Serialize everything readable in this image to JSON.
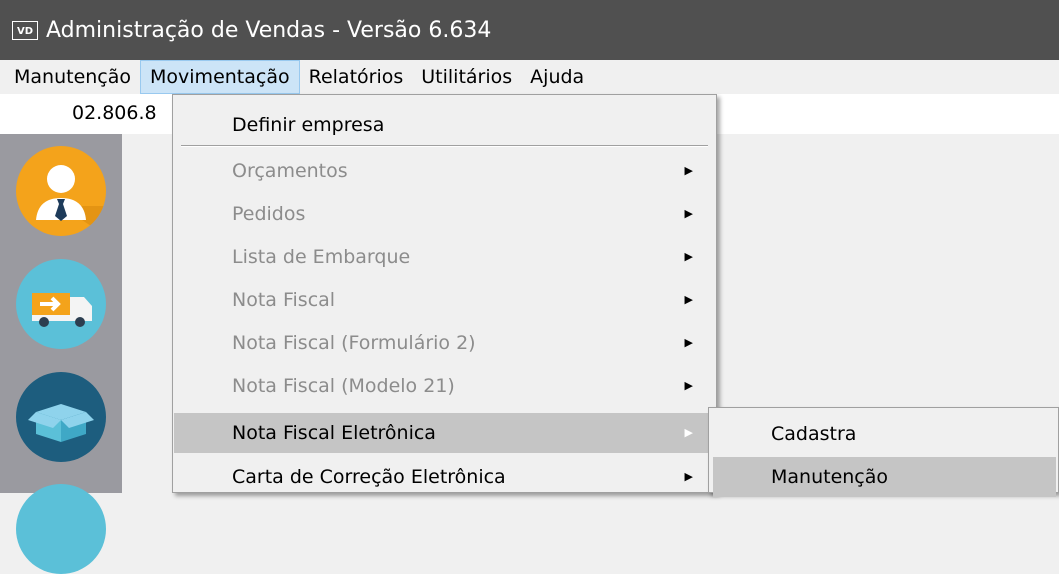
{
  "window": {
    "app_icon": "VD",
    "title": "Administração de Vendas - Versão 6.634"
  },
  "menubar": {
    "items": [
      {
        "label": "Manutenção"
      },
      {
        "label": "Movimentação"
      },
      {
        "label": "Relatórios"
      },
      {
        "label": "Utilitários"
      },
      {
        "label": "Ajuda"
      }
    ],
    "active": "Movimentação"
  },
  "company_field": {
    "value": "02.806.8"
  },
  "sidepanel": {
    "icons": [
      "user-tie-icon",
      "delivery-truck-icon",
      "open-box-icon",
      "partial-icon"
    ]
  },
  "dropdown": {
    "items": [
      {
        "label": "Definir empresa",
        "disabled": false,
        "submenu": false
      },
      {
        "label": "Orçamentos",
        "disabled": true,
        "submenu": true
      },
      {
        "label": "Pedidos",
        "disabled": true,
        "submenu": true
      },
      {
        "label": "Lista de Embarque",
        "disabled": true,
        "submenu": true
      },
      {
        "label": "Nota Fiscal",
        "disabled": true,
        "submenu": true
      },
      {
        "label": "Nota Fiscal (Formulário 2)",
        "disabled": true,
        "submenu": true
      },
      {
        "label": "Nota Fiscal (Modelo 21)",
        "disabled": true,
        "submenu": true
      },
      {
        "label": "Nota Fiscal Eletrônica",
        "disabled": false,
        "submenu": true,
        "highlighted": true
      },
      {
        "label": "Carta de Correção Eletrônica",
        "disabled": false,
        "submenu": true
      }
    ]
  },
  "submenu": {
    "items": [
      {
        "label": "Cadastra"
      },
      {
        "label": "Manutenção",
        "highlighted": true
      }
    ]
  },
  "colors": {
    "titlebar": "#505050",
    "highlight": "#c5c5c5",
    "active_menu": "#cce4f7",
    "disabled_text": "#8c8c8c"
  }
}
